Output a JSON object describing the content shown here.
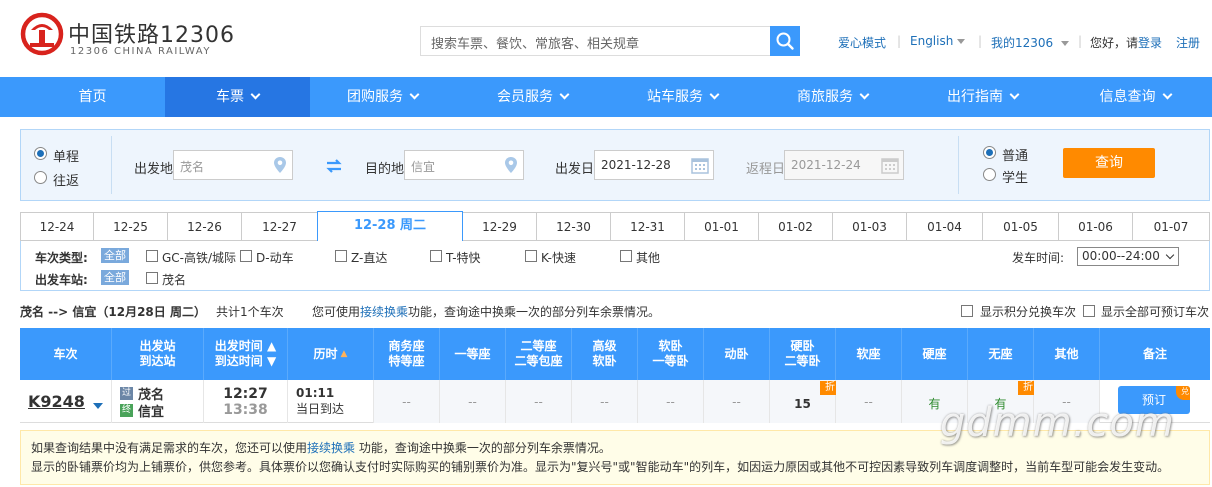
{
  "header": {
    "logo_cn": "中国铁路12306",
    "logo_en": "12306 CHINA RAILWAY",
    "search_placeholder": "搜索车票、餐饮、常旅客、相关规章",
    "links": {
      "care_mode": "爱心模式",
      "english": "English",
      "my12306": "我的12306",
      "greeting": "您好，请",
      "login": "登录",
      "register": "注册"
    }
  },
  "nav": {
    "items": [
      {
        "label": "首页"
      },
      {
        "label": "车票"
      },
      {
        "label": "团购服务"
      },
      {
        "label": "会员服务"
      },
      {
        "label": "站车服务"
      },
      {
        "label": "商旅服务"
      },
      {
        "label": "出行指南"
      },
      {
        "label": "信息查询"
      }
    ]
  },
  "query": {
    "trip_types": {
      "one_way": "单程",
      "round_trip": "往返"
    },
    "from_label": "出发地",
    "from_value": "茂名",
    "to_label": "目的地",
    "to_value": "信宜",
    "depart_label": "出发日",
    "depart_value": "2021-12-28",
    "return_label": "返程日",
    "return_value": "2021-12-24",
    "passenger_types": {
      "normal": "普通",
      "student": "学生"
    },
    "submit": "查询"
  },
  "dates": [
    {
      "label": "12-24"
    },
    {
      "label": "12-25"
    },
    {
      "label": "12-26"
    },
    {
      "label": "12-27"
    },
    {
      "label": "12-28 周二"
    },
    {
      "label": "12-29"
    },
    {
      "label": "12-30"
    },
    {
      "label": "12-31"
    },
    {
      "label": "01-01"
    },
    {
      "label": "01-02"
    },
    {
      "label": "01-03"
    },
    {
      "label": "01-04"
    },
    {
      "label": "01-05"
    },
    {
      "label": "01-06"
    },
    {
      "label": "01-07"
    }
  ],
  "filters": {
    "train_type_label": "车次类型:",
    "all": "全部",
    "train_types": [
      "GC-高铁/城际",
      "D-动车",
      "Z-直达",
      "T-特快",
      "K-快速",
      "其他"
    ],
    "station_label": "出发车站:",
    "stations": [
      "茂名"
    ],
    "time_label": "发车时间:",
    "time_value": "00:00--24:00"
  },
  "summary": {
    "route": "茂名 --> 信宜（12月28日  周二）",
    "count": "共计1个车次",
    "hint_pre": "您可使用",
    "hint_link": "接续换乘",
    "hint_post": "功能，查询途中换乘一次的部分列车余票情况。",
    "opt_points": "显示积分兑换车次",
    "opt_all": "显示全部可预订车次"
  },
  "table": {
    "headers": {
      "train": "车次",
      "stations1": "出发站",
      "stations2": "到达站",
      "time1": "出发时间",
      "time2": "到达时间",
      "duration": "历时",
      "business1": "商务座",
      "business2": "特等座",
      "first": "一等座",
      "second1": "二等座",
      "second2": "二等包座",
      "premium1": "高级",
      "premium2": "软卧",
      "soft1": "软卧",
      "soft2": "一等卧",
      "dongwo": "动卧",
      "hard1": "硬卧",
      "hard2": "二等卧",
      "softseat": "软座",
      "hardseat": "硬座",
      "noseat": "无座",
      "other": "其他",
      "remark": "备注"
    },
    "row": {
      "train_no": "K9248",
      "from_tag": "过",
      "from": "茂名",
      "to_tag": "终",
      "to": "信宜",
      "depart": "12:27",
      "arrive": "13:38",
      "duration": "01:11",
      "arrive_day": "当日到达",
      "business": "--",
      "first": "--",
      "second": "--",
      "premium": "--",
      "soft": "--",
      "dongwo": "--",
      "hard": "15",
      "softseat": "--",
      "hardseat": "有",
      "noseat": "有",
      "other": "--",
      "discount": "折",
      "book": "预订",
      "book_badge": "兑"
    }
  },
  "notice": {
    "line1_pre": "如果查询结果中没有满足需求的车次，您还可以使用",
    "line1_link": "接续换乘",
    "line1_post": " 功能，查询途中换乘一次的部分列车余票情况。",
    "line2": "显示的卧铺票价均为上铺票价，供您参考。具体票价以您确认支付时实际购买的铺别票价为准。显示为\"复兴号\"或\"智能动车\"的列车，如因运力原因或其他不可控因素导致列车调度调整时，当前车型可能会发生变动。"
  },
  "watermark": "gdmm.com",
  "colors": {
    "primary": "#3b99fc",
    "nav_active": "#2676e3",
    "accent": "#ff8a00",
    "logo_red": "#d8231d",
    "available": "#2e8b2e"
  }
}
